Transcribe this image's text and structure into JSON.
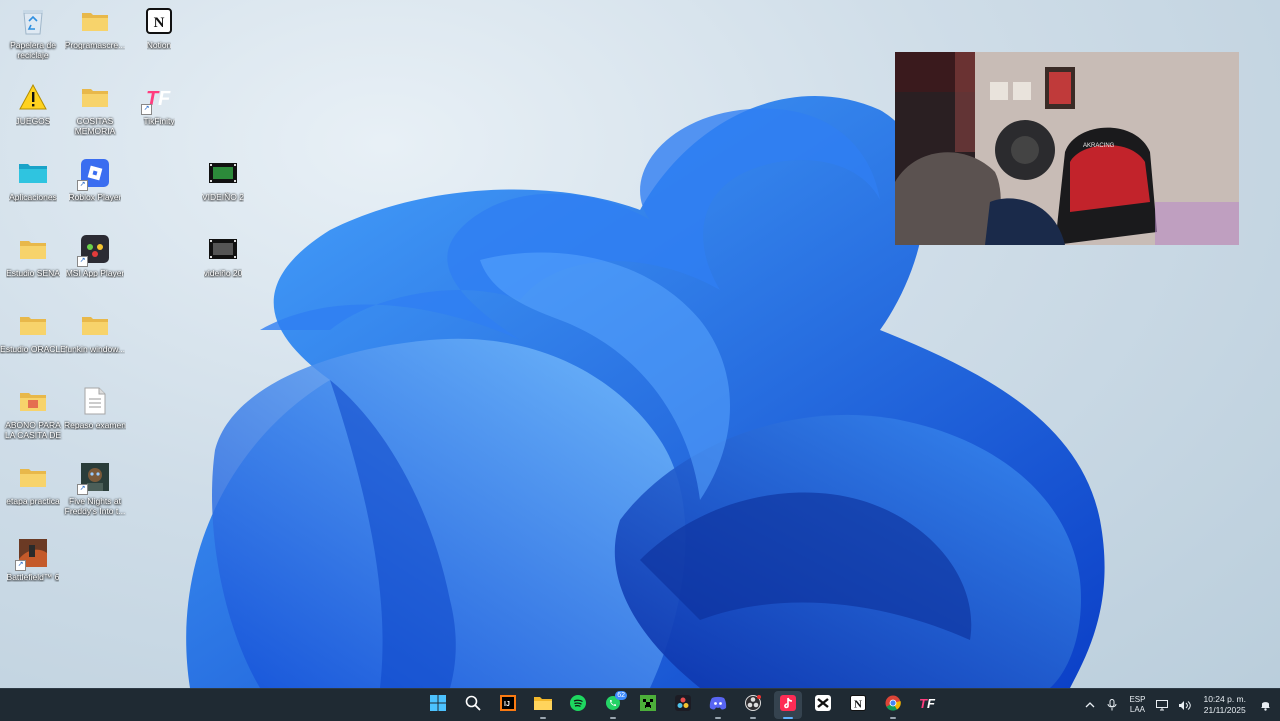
{
  "desktop": {
    "icons": [
      {
        "name": "recycle-bin",
        "label": "Papelera de reciclaje"
      },
      {
        "name": "programascre",
        "label": "Programascre..."
      },
      {
        "name": "notion",
        "label": "Notion"
      },
      {
        "name": "juegos",
        "label": "JUEGOS"
      },
      {
        "name": "cositas-memoria",
        "label": "COSITAS MEMORIA"
      },
      {
        "name": "tikfinity",
        "label": "TikFinity"
      },
      {
        "name": "aplicaciones",
        "label": "Aplicaciones"
      },
      {
        "name": "roblox-player",
        "label": "Roblox Player"
      },
      {
        "name": "videino2",
        "label": "VIDEIÑO 2"
      },
      {
        "name": "estudio-sena",
        "label": "Estudio SENA"
      },
      {
        "name": "msi-app-player",
        "label": "MSI App Player"
      },
      {
        "name": "videino20",
        "label": "videiño 20"
      },
      {
        "name": "estudio-oracle",
        "label": "Estudio ORACLE"
      },
      {
        "name": "funkin-window",
        "label": "funkin window..."
      },
      {
        "name": "abono-casita",
        "label": "ABONO PARA LA CASITA DE PALA"
      },
      {
        "name": "repaso-examen",
        "label": "Repaso examen"
      },
      {
        "name": "etapa-practica",
        "label": "etapa practica"
      },
      {
        "name": "fnaf",
        "label": "Five Nights at Freddy's Into t..."
      },
      {
        "name": "battlefield6",
        "label": "Battlefield™ 6"
      }
    ]
  },
  "webcam": {
    "chair_brand": "AKRACING"
  },
  "taskbar": {
    "apps": [
      {
        "name": "start",
        "icon": "windows-icon"
      },
      {
        "name": "search",
        "icon": "search-icon"
      },
      {
        "name": "intellij",
        "icon": "ij-icon"
      },
      {
        "name": "file-explorer",
        "icon": "folder-icon"
      },
      {
        "name": "spotify",
        "icon": "spotify-icon"
      },
      {
        "name": "whatsapp",
        "icon": "whatsapp-icon",
        "badge": "62"
      },
      {
        "name": "minecraft",
        "icon": "creeper-icon"
      },
      {
        "name": "davinci",
        "icon": "davinci-icon"
      },
      {
        "name": "discord",
        "icon": "discord-icon"
      },
      {
        "name": "obs",
        "icon": "obs-icon"
      },
      {
        "name": "tiktok",
        "icon": "tiktok-icon"
      },
      {
        "name": "capcut",
        "icon": "capcut-icon"
      },
      {
        "name": "notion",
        "icon": "notion-icon"
      },
      {
        "name": "chrome",
        "icon": "chrome-icon"
      },
      {
        "name": "tikfinity",
        "icon": "tikfinity-icon"
      }
    ],
    "tray": {
      "language_top": "ESP",
      "language_bottom": "LAA",
      "time": "10:24 p. m.",
      "date": "21/11/2025"
    }
  }
}
